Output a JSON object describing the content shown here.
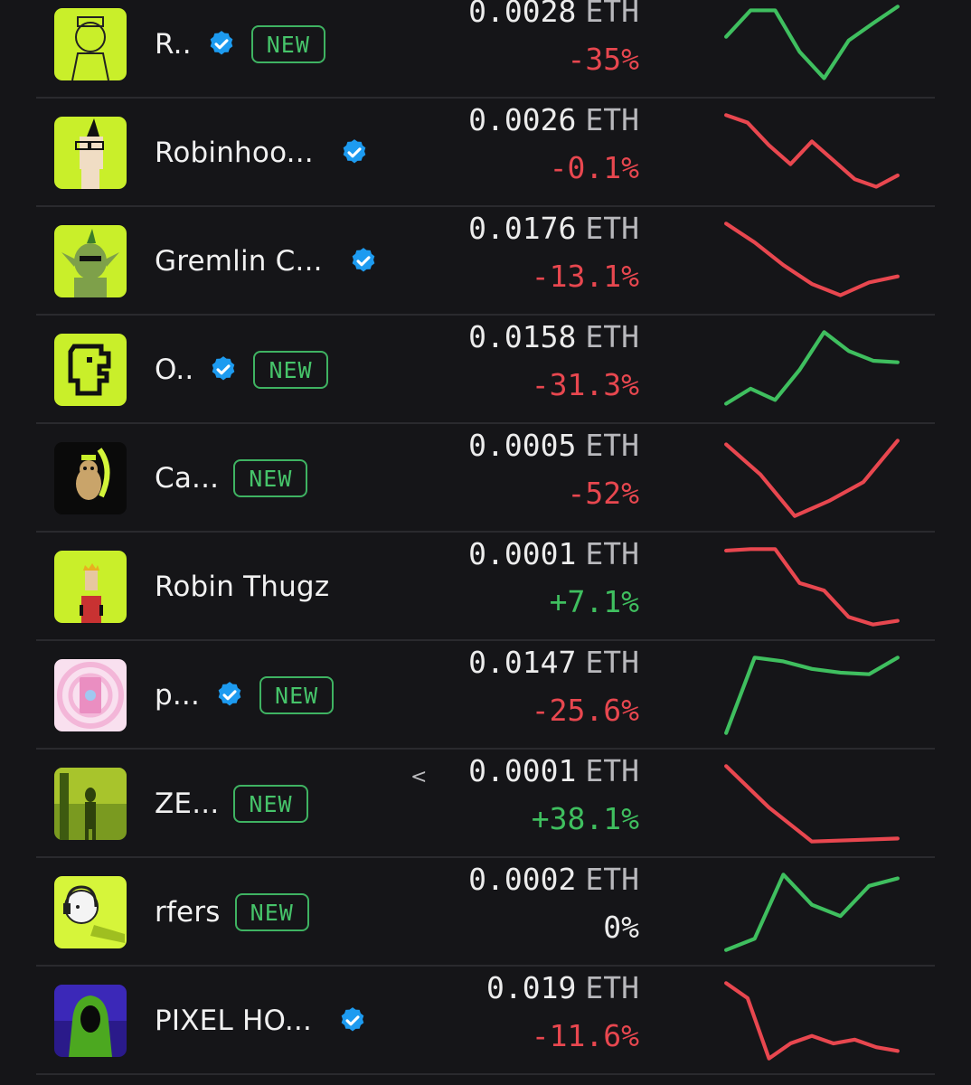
{
  "colors": {
    "background": "#151518",
    "negative": "#e8474f",
    "positive": "#3fbf5f",
    "verified": "#1d9bf0",
    "new_badge": "#46c46a"
  },
  "rows": [
    {
      "name": "R..",
      "verified": true,
      "new": true,
      "new_label": "NEW",
      "price": "0.0028",
      "unit": "ETH",
      "change": "-35%",
      "trend": "pos",
      "thumb_icon": "robot-girl-avatar-icon",
      "spark": [
        0.6,
        0.95,
        0.95,
        0.4,
        0.05,
        0.55,
        0.78,
        1.0
      ]
    },
    {
      "name": "Robinhoo...",
      "verified": true,
      "new": false,
      "new_label": "",
      "price": "0.0026",
      "unit": "ETH",
      "change": "-0.1%",
      "trend": "neg",
      "thumb_icon": "punk-avatar-icon",
      "spark": [
        1.0,
        0.9,
        0.6,
        0.35,
        0.65,
        0.4,
        0.15,
        0.05,
        0.2
      ]
    },
    {
      "name": "Gremlin C...",
      "verified": true,
      "new": false,
      "new_label": "",
      "price": "0.0176",
      "unit": "ETH",
      "change": "-13.1%",
      "trend": "neg",
      "thumb_icon": "gremlin-avatar-icon",
      "spark": [
        1.0,
        0.75,
        0.45,
        0.2,
        0.05,
        0.22,
        0.3
      ]
    },
    {
      "name": "O..",
      "verified": true,
      "new": true,
      "new_label": "NEW",
      "price": "0.0158",
      "unit": "ETH",
      "change": "-31.3%",
      "trend": "pos",
      "thumb_icon": "pixel-figure-icon",
      "spark": [
        0.05,
        0.25,
        0.1,
        0.5,
        1.0,
        0.75,
        0.62,
        0.6
      ]
    },
    {
      "name": "Ca...",
      "verified": false,
      "new": true,
      "new_label": "NEW",
      "price": "0.0005",
      "unit": "ETH",
      "change": "-52%",
      "trend": "neg",
      "thumb_icon": "cat-avatar-icon",
      "spark": [
        0.95,
        0.55,
        0.0,
        0.2,
        0.45,
        1.0
      ]
    },
    {
      "name": "Robin Thugz",
      "verified": false,
      "new": false,
      "new_label": "",
      "price": "0.0001",
      "unit": "ETH",
      "change": "+7.1%",
      "trend": "pos-text",
      "thumb_icon": "king-avatar-icon",
      "spark": [
        0.98,
        1.0,
        1.0,
        0.55,
        0.45,
        0.1,
        0.0,
        0.05
      ]
    },
    {
      "name": "p...",
      "verified": true,
      "new": true,
      "new_label": "NEW",
      "price": "0.0147",
      "unit": "ETH",
      "change": "-25.6%",
      "trend": "pos",
      "thumb_icon": "card-pack-icon",
      "spark": [
        0.0,
        1.0,
        0.95,
        0.85,
        0.8,
        0.78,
        1.0
      ]
    },
    {
      "name": "ZE...",
      "verified": false,
      "new": true,
      "new_label": "NEW",
      "price": "0.0001",
      "unit": "ETH",
      "change": "+38.1%",
      "trend": "neg-chart",
      "thumb_icon": "statue-art-icon",
      "spark": [
        1.0,
        0.45,
        0.0,
        0.02,
        0.04
      ]
    },
    {
      "name": "rfers",
      "verified": false,
      "new": true,
      "new_label": "NEW",
      "price": "0.0002",
      "unit": "ETH",
      "change": "0%",
      "trend": "pos-neutral",
      "thumb_icon": "headphone-avatar-icon",
      "spark": [
        0.0,
        0.15,
        1.0,
        0.6,
        0.45,
        0.85,
        0.95
      ]
    },
    {
      "name": "PIXEL HO...",
      "verified": true,
      "new": false,
      "new_label": "",
      "price": "0.019",
      "unit": "ETH",
      "change": "-11.6%",
      "trend": "neg",
      "thumb_icon": "hooded-figure-icon",
      "spark": [
        1.0,
        0.8,
        0.0,
        0.2,
        0.3,
        0.2,
        0.25,
        0.15,
        0.1
      ]
    }
  ],
  "stray_glyph": "<"
}
